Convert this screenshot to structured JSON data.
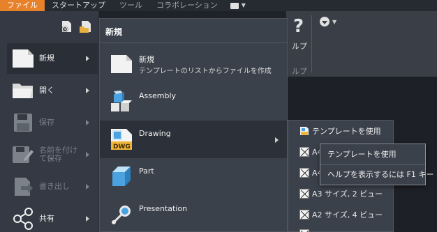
{
  "menubar": {
    "items": [
      "ファイル",
      "スタートアップ",
      "ツール",
      "コラボレーション"
    ]
  },
  "ribbon": {
    "help_label": "ルプ",
    "help_group": "ルプ"
  },
  "left_menu": {
    "items": [
      {
        "label": "新規",
        "icon": "new-doc-icon",
        "enabled": true,
        "selected": true
      },
      {
        "label": "開く",
        "icon": "folder-open-icon",
        "enabled": true,
        "selected": false
      },
      {
        "label": "保存",
        "icon": "save-icon",
        "enabled": false,
        "selected": false
      },
      {
        "label": "名前を付けて保存",
        "line1": "名前を付け",
        "line2": "て保存",
        "icon": "save-as-icon",
        "enabled": false,
        "selected": false
      },
      {
        "label": "書き出し",
        "icon": "export-icon",
        "enabled": false,
        "selected": false
      },
      {
        "label": "共有",
        "icon": "share-icon",
        "enabled": true,
        "selected": false
      }
    ]
  },
  "new_panel": {
    "header": "新規",
    "items": [
      {
        "title": "新規",
        "desc": "テンプレートのリストからファイルを作成",
        "icon": "new-doc-icon"
      },
      {
        "title": "Assembly",
        "icon": "assembly-icon"
      },
      {
        "title": "Drawing",
        "icon": "drawing-icon",
        "badge": "DWG"
      },
      {
        "title": "Part",
        "icon": "part-icon"
      },
      {
        "title": "Presentation",
        "icon": "presentation-icon"
      }
    ]
  },
  "flyout": {
    "header": "テンプレートを使用",
    "rows": [
      "A4",
      "A4",
      "A3 サイズ, 2 ビュー",
      "A2 サイズ, 4 ビュー"
    ]
  },
  "context_menu": {
    "items": [
      "テンプレートを使用",
      "ヘルプを表示するには F1 キー"
    ]
  },
  "colors": {
    "accent": "#e8822a",
    "panel": "#3b414b",
    "sidebar": "#343943"
  }
}
